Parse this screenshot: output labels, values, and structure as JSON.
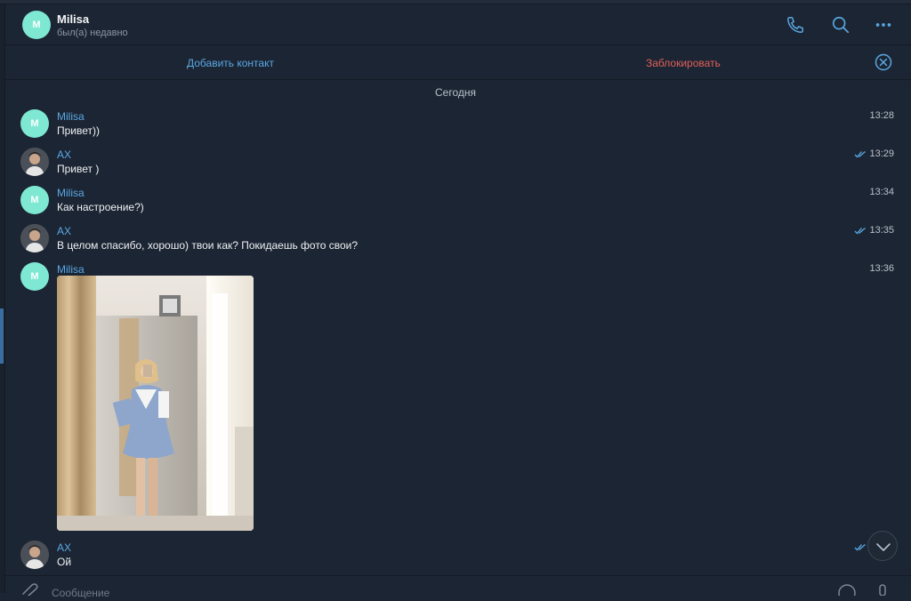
{
  "header": {
    "avatar_letter": "M",
    "name": "Milisa",
    "status": "был(а) недавно",
    "icons": [
      "phone-icon",
      "search-icon",
      "more-icon"
    ]
  },
  "actions": {
    "add_contact": "Добавить контакт",
    "block": "Заблокировать"
  },
  "date_separator": "Сегодня",
  "messages": [
    {
      "sender": "Milisa",
      "avatar_letter": "M",
      "text": "Привет))",
      "time": "13:28",
      "read": false
    },
    {
      "sender": "AX",
      "avatar_letter": "",
      "text": "Привет )",
      "time": "13:29",
      "read": true
    },
    {
      "sender": "Milisa",
      "avatar_letter": "M",
      "text": "Как настроение?)",
      "time": "13:34",
      "read": false
    },
    {
      "sender": "AX",
      "avatar_letter": "",
      "text": "В целом спасибо,  хорошо) твои как? Покидаешь фото свои?",
      "time": "13:35",
      "read": true
    },
    {
      "sender": "Milisa",
      "avatar_letter": "M",
      "text": "",
      "time": "13:36",
      "read": false,
      "attachment": "photo"
    },
    {
      "sender": "AX",
      "avatar_letter": "",
      "text": "Ой",
      "time": "",
      "read": true
    }
  ],
  "composer": {
    "placeholder": "Сообщение"
  },
  "colors": {
    "background": "#1c2533",
    "accent_blue": "#5aa8e4",
    "danger_red": "#e0605a",
    "avatar_mint": "#7ee8d3"
  }
}
